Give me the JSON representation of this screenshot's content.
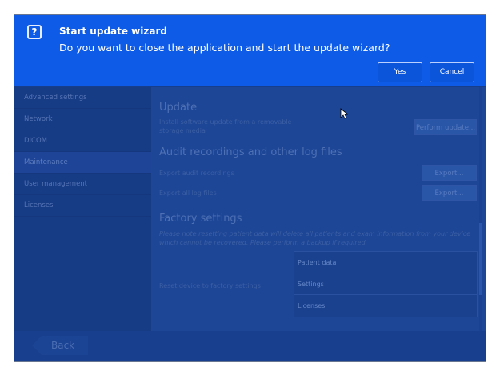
{
  "dialog": {
    "title": "Start update wizard",
    "message": "Do you want to close the application and start the update wizard?",
    "icon": "question-icon",
    "yes_label": "Yes",
    "cancel_label": "Cancel"
  },
  "sidebar": {
    "items": [
      {
        "label": "Advanced settings"
      },
      {
        "label": "Network"
      },
      {
        "label": "DICOM"
      },
      {
        "label": "Maintenance"
      },
      {
        "label": "User management"
      },
      {
        "label": "Licenses"
      }
    ]
  },
  "content": {
    "update": {
      "heading": "Update",
      "description_line1": "Install software update from a removable",
      "description_line2": "storage media",
      "button": "Perform update..."
    },
    "audit": {
      "heading": "Audit recordings and other log files",
      "export_audit_label": "Export audit recordings",
      "export_audit_button": "Export...",
      "export_logs_label": "Export all log files",
      "export_logs_button": "Export..."
    },
    "factory": {
      "heading": "Factory settings",
      "warning_line1": "Please note resetting patient data will delete all patients and exam information from your device",
      "warning_line2": "which cannot be recovered. Please perform a backup if required.",
      "reset_label": "Reset device to factory settings",
      "options": [
        {
          "label": "Patient data"
        },
        {
          "label": "Settings"
        },
        {
          "label": "Licenses"
        }
      ]
    }
  },
  "footer": {
    "back_label": "Back"
  }
}
